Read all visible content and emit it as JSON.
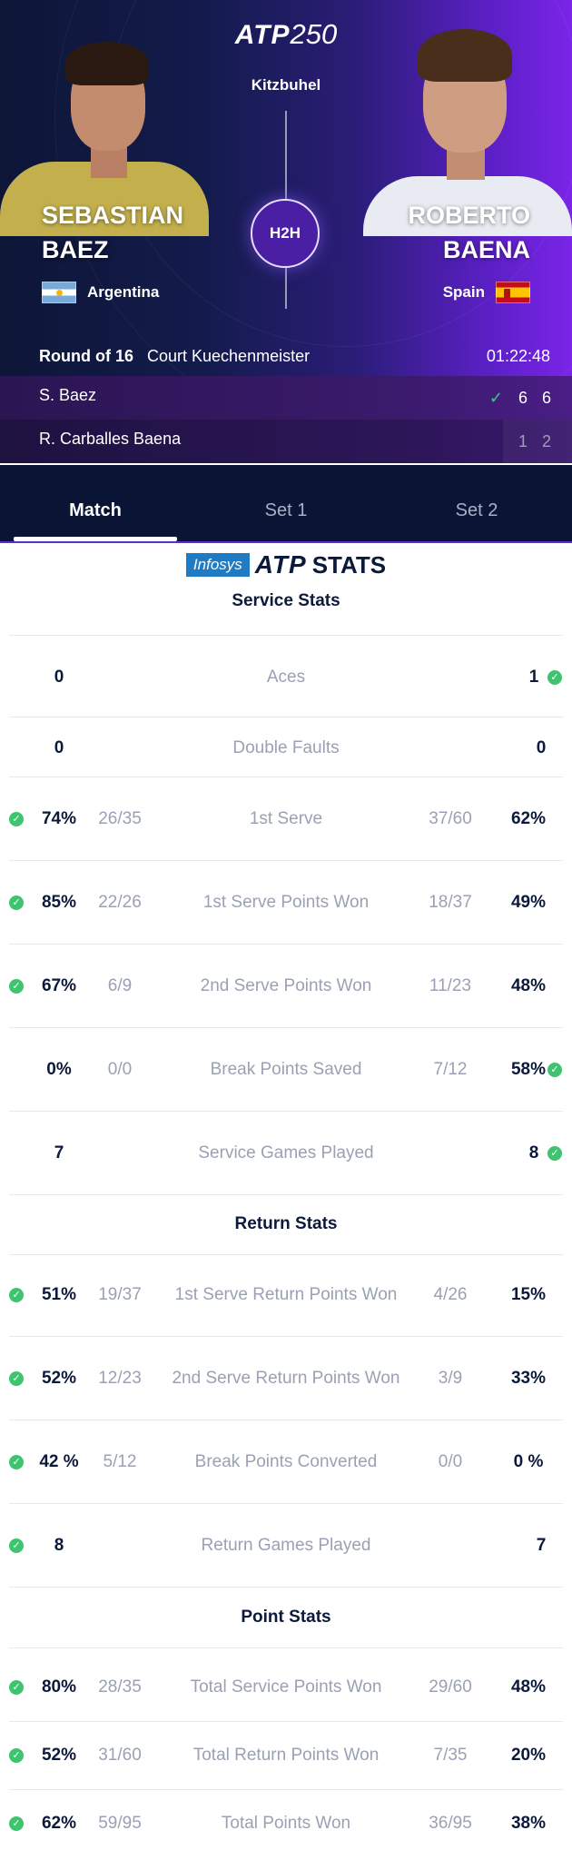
{
  "header": {
    "brand_atp": "ATP",
    "brand_250": "250",
    "tournament": "Kitzbuhel",
    "h2h": "H2H"
  },
  "player1": {
    "first_name": "SEBASTIAN",
    "last_name": "BAEZ",
    "country": "Argentina",
    "flag": "argentina-flag"
  },
  "player2": {
    "first_name": "ROBERTO",
    "last_name": "BAENA",
    "country": "Spain",
    "flag": "spain-flag"
  },
  "match_info": {
    "round": "Round of 16",
    "court": "Court Kuechenmeister",
    "duration": "01:22:48"
  },
  "scoreboard": [
    {
      "name": "S. Baez",
      "winner": true,
      "sets": [
        "6",
        "6"
      ]
    },
    {
      "name": "R. Carballes Baena",
      "winner": false,
      "sets": [
        "1",
        "2"
      ]
    }
  ],
  "tabs": [
    "Match",
    "Set 1",
    "Set 2"
  ],
  "active_tab": "Match",
  "stats_brand": {
    "sponsor": "Infosys",
    "atp": "ATP",
    "stats": "STATS"
  },
  "colors": {
    "accent": "#5a2fd0",
    "check": "#3ec46f",
    "navy": "#0b1a3a"
  },
  "sections": {
    "service": "Service Stats",
    "return": "Return Stats",
    "point": "Point Stats"
  },
  "service_stats": [
    {
      "label": "Aces",
      "p1": "0",
      "p2": "1",
      "winner": "p2"
    },
    {
      "label": "Double Faults",
      "p1": "0",
      "p2": "0",
      "winner": ""
    },
    {
      "label": "1st Serve",
      "p1": "74%",
      "p1_frac": "26/35",
      "p2_frac": "37/60",
      "p2": "62%",
      "winner": "p1"
    },
    {
      "label": "1st Serve Points Won",
      "p1": "85%",
      "p1_frac": "22/26",
      "p2_frac": "18/37",
      "p2": "49%",
      "winner": "p1"
    },
    {
      "label": "2nd Serve Points Won",
      "p1": "67%",
      "p1_frac": "6/9",
      "p2_frac": "11/23",
      "p2": "48%",
      "winner": "p1"
    },
    {
      "label": "Break Points Saved",
      "p1": "0%",
      "p1_frac": "0/0",
      "p2_frac": "7/12",
      "p2": "58%",
      "winner": "p2"
    },
    {
      "label": "Service Games Played",
      "p1": "7",
      "p2": "8",
      "winner": "p2"
    }
  ],
  "return_stats": [
    {
      "label": "1st Serve Return Points Won",
      "p1": "51%",
      "p1_frac": "19/37",
      "p2_frac": "4/26",
      "p2": "15%",
      "winner": "p1"
    },
    {
      "label": "2nd Serve Return Points Won",
      "p1": "52%",
      "p1_frac": "12/23",
      "p2_frac": "3/9",
      "p2": "33%",
      "winner": "p1"
    },
    {
      "label": "Break Points Converted",
      "p1": "42 %",
      "p1_frac": "5/12",
      "p2_frac": "0/0",
      "p2": "0 %",
      "winner": "p1"
    },
    {
      "label": "Return Games Played",
      "p1": "8",
      "p2": "7",
      "winner": "p1"
    }
  ],
  "point_stats": [
    {
      "label": "Total Service Points Won",
      "p1": "80%",
      "p1_frac": "28/35",
      "p2_frac": "29/60",
      "p2": "48%",
      "winner": "p1"
    },
    {
      "label": "Total Return Points Won",
      "p1": "52%",
      "p1_frac": "31/60",
      "p2_frac": "7/35",
      "p2": "20%",
      "winner": "p1"
    },
    {
      "label": "Total Points Won",
      "p1": "62%",
      "p1_frac": "59/95",
      "p2_frac": "36/95",
      "p2": "38%",
      "winner": "p1"
    }
  ]
}
